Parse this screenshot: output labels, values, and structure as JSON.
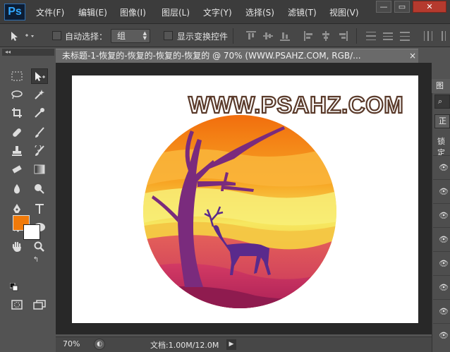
{
  "app": {
    "logo": "Ps"
  },
  "menu": [
    "文件(F)",
    "编辑(E)",
    "图像(I)",
    "图层(L)",
    "文字(Y)",
    "选择(S)",
    "滤镜(T)",
    "视图(V)"
  ],
  "window_controls": {
    "minimize": "—",
    "restore": "▭",
    "close": "✕"
  },
  "options": {
    "auto_select_label": "自动选择：",
    "auto_select_value": "组",
    "show_transform_label": "显示变换控件"
  },
  "toolbox": {
    "collapse": "◂◂"
  },
  "document": {
    "tab_title": "未标题-1-恢复的-恢复的-恢复的-恢复的 @ 70% (WWW.PSAHZ.COM, RGB/...",
    "tab_close": "×",
    "watermark": "WWW.PSAHZ.COM"
  },
  "status": {
    "zoom": "70%",
    "doc_info": "文档:1.00M/12.0M",
    "arrow": "▶"
  },
  "colors": {
    "foreground": "#f07a0a",
    "background": "#ffffff",
    "ui_dark": "#3c3c3c",
    "ui_mid": "#535353"
  },
  "layers_panel": {
    "tab": "图层",
    "search_icon": "⌕",
    "blend_mode": "正",
    "lock_label": "锁定",
    "eye": "👁"
  }
}
